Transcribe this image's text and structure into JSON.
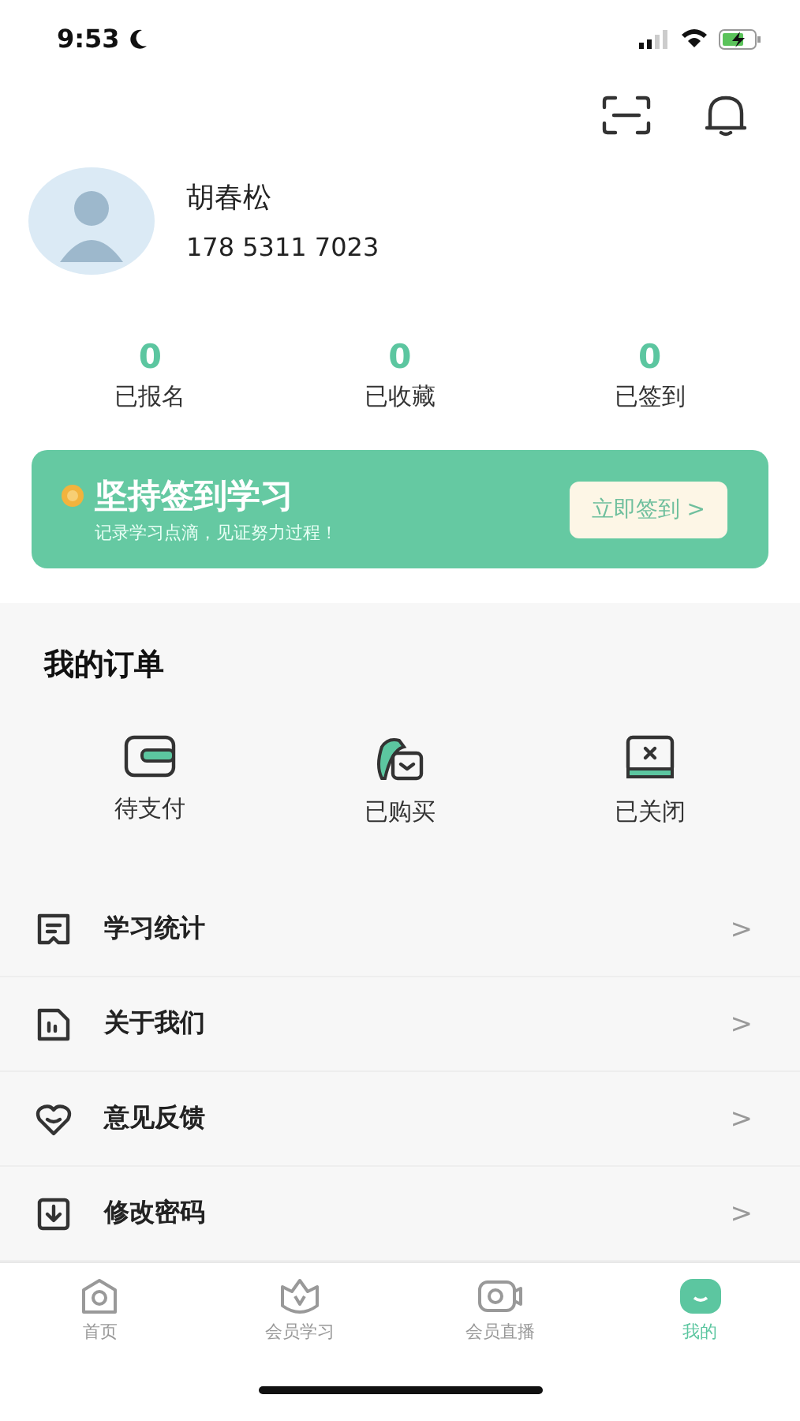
{
  "status_bar": {
    "time": "9:53"
  },
  "profile": {
    "name": "胡春松",
    "phone": "178 5311 7023"
  },
  "stats": [
    {
      "count": "0",
      "label": "已报名"
    },
    {
      "count": "0",
      "label": "已收藏"
    },
    {
      "count": "0",
      "label": "已签到"
    }
  ],
  "banner": {
    "title": "坚持签到学习",
    "subtitle": "记录学习点滴，见证努力过程！",
    "button": "立即签到 >"
  },
  "orders": {
    "title": "我的订单",
    "items": [
      {
        "kind": "wallet",
        "label": "待支付"
      },
      {
        "kind": "bag",
        "label": "已购买"
      },
      {
        "kind": "closed",
        "label": "已关闭"
      }
    ]
  },
  "menu": [
    {
      "kind": "stats",
      "label": "学习统计",
      "chevron": ">"
    },
    {
      "kind": "about",
      "label": "关于我们",
      "chevron": ">"
    },
    {
      "kind": "feedback",
      "label": "意见反馈",
      "chevron": ">"
    },
    {
      "kind": "password",
      "label": "修改密码",
      "chevron": ">"
    }
  ],
  "tab_bar": [
    {
      "kind": "home",
      "label": "首页",
      "selected": false
    },
    {
      "kind": "member",
      "label": "会员学习",
      "selected": false
    },
    {
      "kind": "live",
      "label": "会员直播",
      "selected": false
    },
    {
      "kind": "mine",
      "label": "我的",
      "selected": true
    }
  ]
}
